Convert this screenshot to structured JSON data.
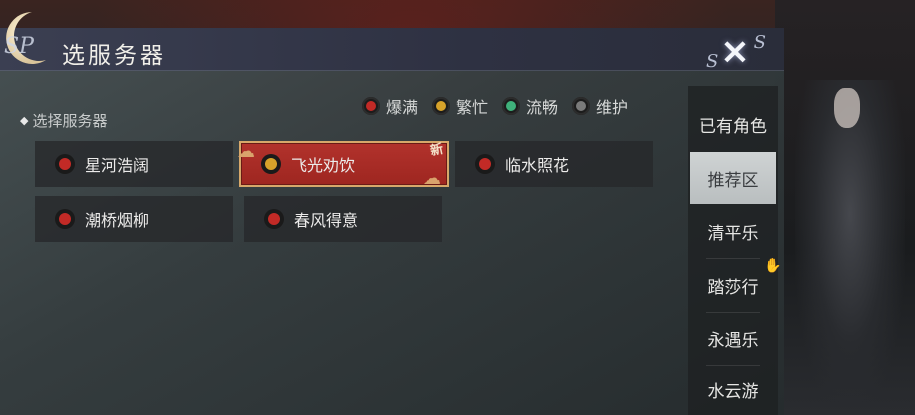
{
  "header": {
    "title": "选服务器",
    "title_deco": "SP",
    "close_label": "×",
    "close_deco_top": "S",
    "close_deco_bottom": "S"
  },
  "legend": [
    {
      "label": "爆满",
      "color": "#c22a26"
    },
    {
      "label": "繁忙",
      "color": "#d6a22a"
    },
    {
      "label": "流畅",
      "color": "#3fb07a"
    },
    {
      "label": "维护",
      "color": "#7a7a7a"
    }
  ],
  "section": {
    "label": "选择服务器"
  },
  "servers": [
    {
      "name": "星河浩阔",
      "status_color": "#c22a26",
      "selected": false
    },
    {
      "name": "飞光劝饮",
      "status_color": "#d6a22a",
      "selected": true,
      "tag": "新"
    },
    {
      "name": "临水照花",
      "status_color": "#c22a26",
      "selected": false
    },
    {
      "name": "潮桥烟柳",
      "status_color": "#c22a26",
      "selected": false
    },
    {
      "name": "春风得意",
      "status_color": "#c22a26",
      "selected": false
    }
  ],
  "tabs": [
    {
      "label": "已有角色",
      "active": false
    },
    {
      "label": "推荐区",
      "active": true
    },
    {
      "label": "清平乐",
      "active": false
    },
    {
      "label": "踏莎行",
      "active": false
    },
    {
      "label": "永遇乐",
      "active": false
    },
    {
      "label": "水云游",
      "active": false
    }
  ]
}
